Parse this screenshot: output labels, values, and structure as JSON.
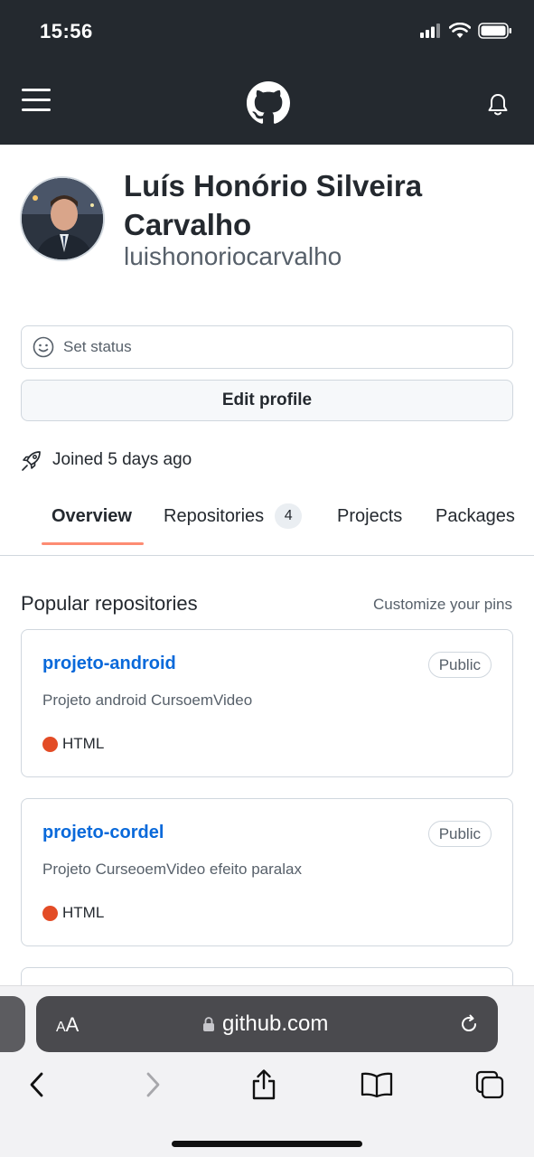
{
  "status_bar": {
    "time": "15:56"
  },
  "header": {
    "menu_icon": "hamburger-menu-icon",
    "logo_icon": "github-logo-icon",
    "bell_icon": "bell-icon"
  },
  "profile": {
    "full_name": "Luís Honório Silveira Carvalho",
    "username": "luishonoriocarvalho",
    "set_status_label": "Set status",
    "edit_profile_label": "Edit profile",
    "joined_text": "Joined 5 days ago"
  },
  "tabs": [
    {
      "label": "Overview",
      "active": true
    },
    {
      "label": "Repositories",
      "count": "4"
    },
    {
      "label": "Projects"
    },
    {
      "label": "Packages"
    }
  ],
  "popular": {
    "title": "Popular repositories",
    "customize_label": "Customize your pins",
    "repos": [
      {
        "name": "projeto-android",
        "visibility": "Public",
        "description": "Projeto android CursoemVideo",
        "language": "HTML",
        "language_color": "#e34c26"
      },
      {
        "name": "projeto-cordel",
        "visibility": "Public",
        "description": "Projeto CurseoemVideo efeito paralax",
        "language": "HTML",
        "language_color": "#e34c26"
      }
    ]
  },
  "browser": {
    "aa_big": "A",
    "aa_small": "A",
    "url": "github.com"
  },
  "colors": {
    "header_bg": "#24292f",
    "link": "#0969da",
    "tab_underline": "#fd8c73"
  }
}
